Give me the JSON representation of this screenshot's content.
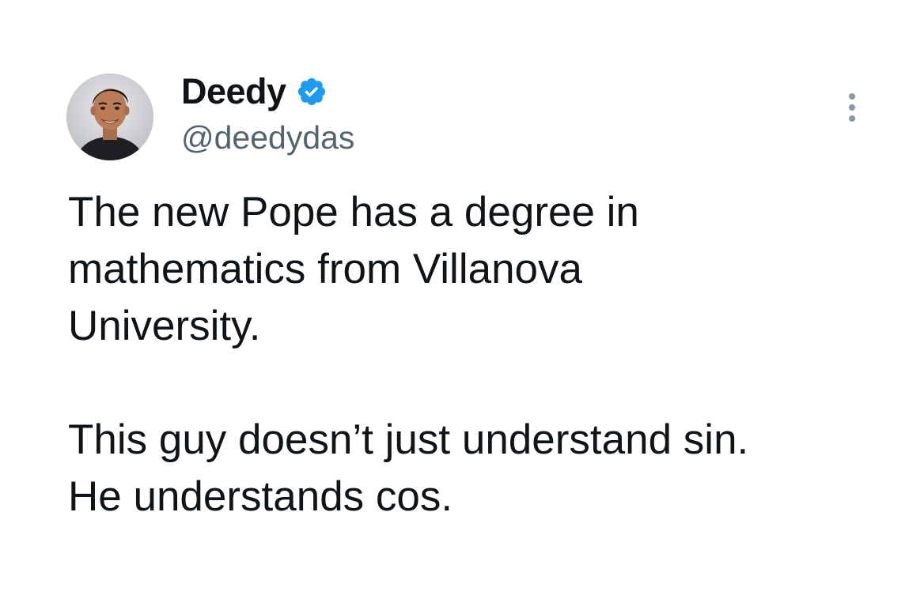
{
  "author": {
    "display_name": "Deedy",
    "handle": "@deedydas",
    "verified": true
  },
  "tweet": {
    "lines_paragraph_1": [
      "The new Pope has a degree in",
      "mathematics from Villanova",
      "University."
    ],
    "lines_paragraph_2": [
      "This guy doesn’t just understand sin.",
      "He understands cos."
    ]
  },
  "icons": {
    "verified": "verified-badge-icon",
    "more": "more-options-icon"
  },
  "colors": {
    "text_primary": "#0f1419",
    "text_secondary": "#536471",
    "verified_blue": "#1d9bf0",
    "background": "#ffffff"
  }
}
